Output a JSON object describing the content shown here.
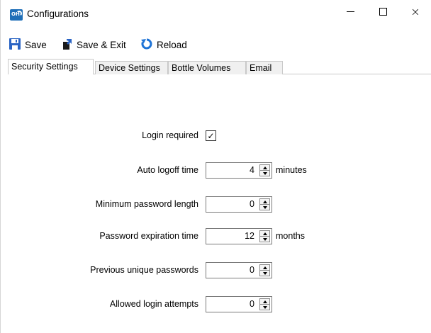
{
  "window": {
    "title": "Configurations",
    "app_icon": "oh-app-icon",
    "controls": {
      "minimize": "minimize-icon",
      "maximize": "maximize-icon",
      "close": "×"
    }
  },
  "toolbar": {
    "save_label": "Save",
    "save_exit_label": "Save & Exit",
    "reload_label": "Reload"
  },
  "tabs": [
    {
      "label": "Security Settings",
      "active": true
    },
    {
      "label": "Device Settings",
      "active": false
    },
    {
      "label": "Bottle Volumes",
      "active": false
    },
    {
      "label": "Email",
      "active": false
    }
  ],
  "security": {
    "login_required": {
      "label": "Login required",
      "checked": true,
      "mark": "✓"
    },
    "auto_logoff": {
      "label": "Auto logoff time",
      "value": "4",
      "unit": "minutes"
    },
    "min_password_length": {
      "label": "Minimum password length",
      "value": "0"
    },
    "password_expiration": {
      "label": "Password expiration time",
      "value": "12",
      "unit": "months"
    },
    "previous_unique": {
      "label": "Previous unique passwords",
      "value": "0"
    },
    "login_attempts": {
      "label": "Allowed login attempts",
      "value": "0"
    }
  },
  "colors": {
    "save_icon": "#2a64c4",
    "reload_icon": "#1e73d6",
    "app_icon": "#1f6fb8"
  }
}
